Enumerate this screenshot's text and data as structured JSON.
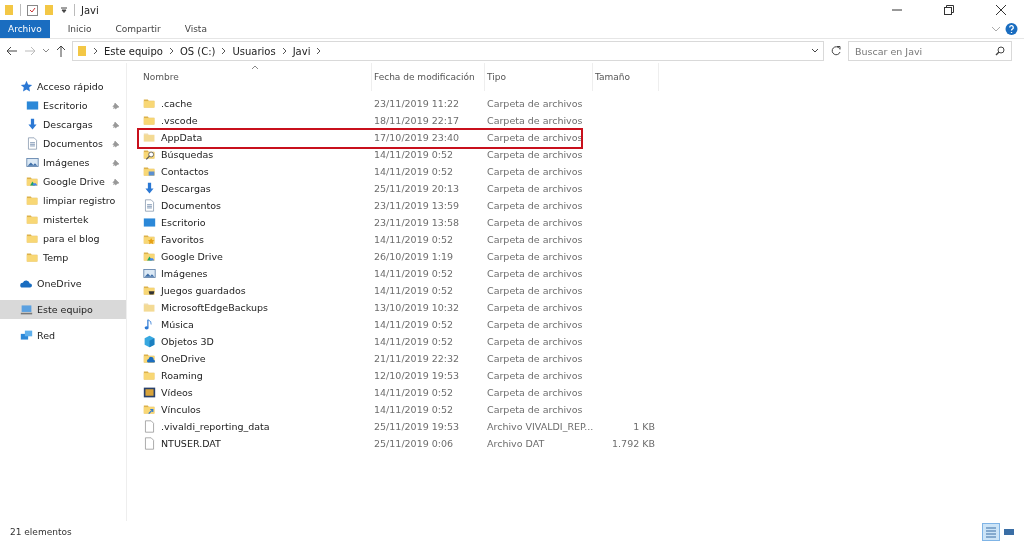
{
  "window": {
    "title": "Javi"
  },
  "ribbon_tabs": [
    {
      "label": "Archivo",
      "selected": true
    },
    {
      "label": "Inicio",
      "selected": false
    },
    {
      "label": "Compartir",
      "selected": false
    },
    {
      "label": "Vista",
      "selected": false
    }
  ],
  "address_bar": {
    "crumbs": [
      "Este equipo",
      "OS (C:)",
      "Usuarios",
      "Javi"
    ]
  },
  "search": {
    "placeholder": "Buscar en Javi"
  },
  "sidebar": {
    "items": [
      {
        "label": "Acceso rápido",
        "kind": "star",
        "selected": false,
        "children": [
          {
            "label": "Escritorio",
            "kind": "desktop",
            "pinned": true,
            "selected": false
          },
          {
            "label": "Descargas",
            "kind": "download",
            "pinned": true,
            "selected": false
          },
          {
            "label": "Documentos",
            "kind": "documents",
            "pinned": true,
            "selected": false
          },
          {
            "label": "Imágenes",
            "kind": "pictures",
            "pinned": true,
            "selected": false
          },
          {
            "label": "Google Drive",
            "kind": "gdrive",
            "pinned": true,
            "selected": false
          },
          {
            "label": "limpiar registro",
            "kind": "folder",
            "pinned": false,
            "selected": false
          },
          {
            "label": "mistertek",
            "kind": "folder",
            "pinned": false,
            "selected": false
          },
          {
            "label": "para el blog",
            "kind": "folder",
            "pinned": false,
            "selected": false
          },
          {
            "label": "Temp",
            "kind": "folder",
            "pinned": false,
            "selected": false
          }
        ]
      },
      {
        "label": "OneDrive",
        "kind": "cloud",
        "selected": false
      },
      {
        "label": "Este equipo",
        "kind": "computer",
        "selected": true
      },
      {
        "label": "Red",
        "kind": "network",
        "selected": false
      }
    ]
  },
  "table": {
    "columns": [
      {
        "label": "Nombre",
        "sorted": true
      },
      {
        "label": "Fecha de modificación",
        "sorted": false
      },
      {
        "label": "Tipo",
        "sorted": false
      },
      {
        "label": "Tamaño",
        "sorted": false
      }
    ],
    "rows": [
      {
        "kind": "folder",
        "name": ".cache",
        "date": "23/11/2019 11:22",
        "type": "Carpeta de archivos",
        "highlighted": false
      },
      {
        "kind": "folder",
        "name": ".vscode",
        "date": "18/11/2019 22:17",
        "type": "Carpeta de archivos",
        "highlighted": false
      },
      {
        "kind": "hidden",
        "name": "AppData",
        "date": "17/10/2019 23:40",
        "type": "Carpeta de archivos",
        "highlighted": true
      },
      {
        "kind": "searches",
        "name": "Búsquedas",
        "date": "14/11/2019 0:52",
        "type": "Carpeta de archivos",
        "highlighted": false
      },
      {
        "kind": "contacts",
        "name": "Contactos",
        "date": "14/11/2019 0:52",
        "type": "Carpeta de archivos",
        "highlighted": false
      },
      {
        "kind": "download",
        "name": "Descargas",
        "date": "25/11/2019 20:13",
        "type": "Carpeta de archivos",
        "highlighted": false
      },
      {
        "kind": "documents",
        "name": "Documentos",
        "date": "23/11/2019 13:59",
        "type": "Carpeta de archivos",
        "highlighted": false
      },
      {
        "kind": "desktop",
        "name": "Escritorio",
        "date": "23/11/2019 13:58",
        "type": "Carpeta de archivos",
        "highlighted": false
      },
      {
        "kind": "favorites",
        "name": "Favoritos",
        "date": "14/11/2019 0:52",
        "type": "Carpeta de archivos",
        "highlighted": false
      },
      {
        "kind": "gdrive",
        "name": "Google Drive",
        "date": "26/10/2019 1:19",
        "type": "Carpeta de archivos",
        "highlighted": false
      },
      {
        "kind": "pictures",
        "name": "Imágenes",
        "date": "14/11/2019 0:52",
        "type": "Carpeta de archivos",
        "highlighted": false
      },
      {
        "kind": "games",
        "name": "Juegos guardados",
        "date": "14/11/2019 0:52",
        "type": "Carpeta de archivos",
        "highlighted": false
      },
      {
        "kind": "hidden",
        "name": "MicrosoftEdgeBackups",
        "date": "13/10/2019 10:32",
        "type": "Carpeta de archivos",
        "highlighted": false
      },
      {
        "kind": "music",
        "name": "Música",
        "date": "14/11/2019 0:52",
        "type": "Carpeta de archivos",
        "highlighted": false
      },
      {
        "kind": "objects3d",
        "name": "Objetos 3D",
        "date": "14/11/2019 0:52",
        "type": "Carpeta de archivos",
        "highlighted": false
      },
      {
        "kind": "onedrive",
        "name": "OneDrive",
        "date": "21/11/2019 22:32",
        "type": "Carpeta de archivos",
        "highlighted": false
      },
      {
        "kind": "folder",
        "name": "Roaming",
        "date": "12/10/2019 19:53",
        "type": "Carpeta de archivos",
        "highlighted": false
      },
      {
        "kind": "videos",
        "name": "Vídeos",
        "date": "14/11/2019 0:52",
        "type": "Carpeta de archivos",
        "highlighted": false
      },
      {
        "kind": "links",
        "name": "Vínculos",
        "date": "14/11/2019 0:52",
        "type": "Carpeta de archivos",
        "highlighted": false
      },
      {
        "kind": "file",
        "name": ".vivaldi_reporting_data",
        "date": "25/11/2019 19:53",
        "type": "Archivo VIVALDI_REP...",
        "size": "1 KB",
        "highlighted": false
      },
      {
        "kind": "file",
        "name": "NTUSER.DAT",
        "date": "25/11/2019 0:06",
        "type": "Archivo DAT",
        "size": "1.792 KB",
        "highlighted": false
      }
    ]
  },
  "status_bar": {
    "count": "21 elementos",
    "views": [
      {
        "kind": "details",
        "selected": true
      },
      {
        "kind": "tiles",
        "selected": false
      }
    ]
  }
}
